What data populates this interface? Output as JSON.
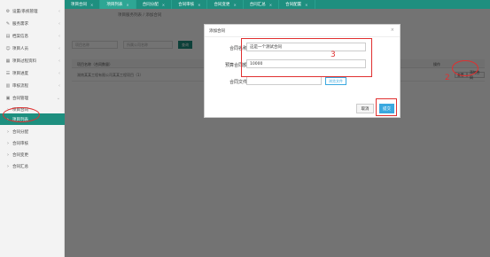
{
  "sidebar": {
    "items": [
      {
        "label": "设置/系统管理",
        "icon": "gear-icon"
      },
      {
        "label": "服务需求",
        "icon": "wrench-icon"
      },
      {
        "label": "档案信息",
        "icon": "folder-icon"
      },
      {
        "label": "项目人员",
        "icon": "user-icon"
      },
      {
        "label": "项目过程资料",
        "icon": "doc-icon"
      },
      {
        "label": "项目进度",
        "icon": "list-icon"
      },
      {
        "label": "审核流程",
        "icon": "flow-icon"
      },
      {
        "label": "合同管理",
        "icon": "contract-icon"
      }
    ],
    "subitems": [
      {
        "label": "项目合同"
      },
      {
        "label": "项目列表"
      },
      {
        "label": "合同分配"
      },
      {
        "label": "合同审核"
      },
      {
        "label": "合同变更"
      },
      {
        "label": "合同汇总"
      }
    ]
  },
  "tabs": [
    {
      "label": "项目合同"
    },
    {
      "label": "项目列表"
    },
    {
      "label": "合同分配"
    },
    {
      "label": "合同审核"
    },
    {
      "label": "合同变更"
    },
    {
      "label": "合同汇总"
    },
    {
      "label": "合同配置"
    }
  ],
  "page": {
    "crumb": "项目服务列表 / 添加合同",
    "search1_placeholder": "项目名称",
    "search2_placeholder": "所属公司名称",
    "query_label": "查询",
    "table": {
      "headers": [
        "项目名称（合同数量）",
        "操作"
      ],
      "row_text": "湖南某某工程有限公司某某工程项目（1）",
      "row_buttons": [
        "查看",
        "添加合同"
      ]
    }
  },
  "modal": {
    "title": "添加合同",
    "close": "×",
    "name_label": "合同名称",
    "name_value": "这是一个测试合同",
    "amount_label": "预算合同额",
    "amount_value": "10000",
    "file_label": "合同文件",
    "upload_label": "浏览文件",
    "cancel_label": "取消",
    "submit_label": "提交"
  },
  "annotations": {
    "n2": "2",
    "n3": "3",
    "n4": "4"
  }
}
